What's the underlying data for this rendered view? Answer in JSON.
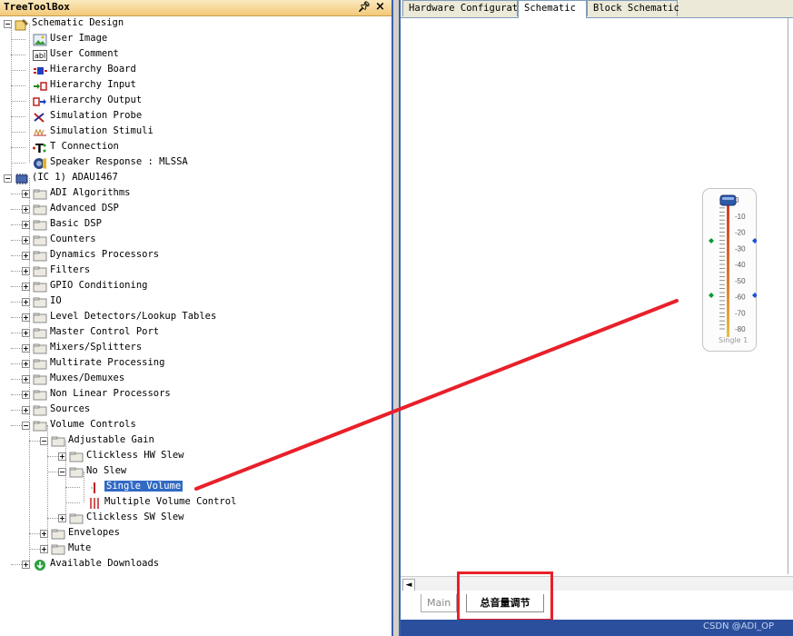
{
  "toolbox": {
    "title": "TreeToolBox",
    "pin_glyph": "٩",
    "close_glyph": "×",
    "items": [
      {
        "label": "Schematic Design",
        "level": 0,
        "expander": "minus",
        "icon": "schematic-design-icon"
      },
      {
        "label": "User Image",
        "level": 1,
        "expander": "",
        "icon": "image-icon"
      },
      {
        "label": "User Comment",
        "level": 1,
        "expander": "",
        "icon": "text-field-icon",
        "icon_text": "abl"
      },
      {
        "label": "Hierarchy Board",
        "level": 1,
        "expander": "",
        "icon": "hierarchy-board-icon"
      },
      {
        "label": "Hierarchy Input",
        "level": 1,
        "expander": "",
        "icon": "hierarchy-input-icon"
      },
      {
        "label": "Hierarchy Output",
        "level": 1,
        "expander": "",
        "icon": "hierarchy-output-icon"
      },
      {
        "label": "Simulation Probe",
        "level": 1,
        "expander": "",
        "icon": "probe-icon"
      },
      {
        "label": "Simulation Stimuli",
        "level": 1,
        "expander": "",
        "icon": "stimuli-icon"
      },
      {
        "label": "T Connection",
        "level": 1,
        "expander": "",
        "icon": "t-connection-icon",
        "icon_text": "T"
      },
      {
        "label": "Speaker Response : MLSSA",
        "level": 1,
        "expander": "",
        "icon": "speaker-icon"
      },
      {
        "label": "(IC 1) ADAU1467",
        "level": 0,
        "expander": "minus",
        "icon": "chip-icon"
      },
      {
        "label": "ADI Algorithms",
        "level": 1,
        "expander": "plus",
        "icon": "folder-icon"
      },
      {
        "label": "Advanced DSP",
        "level": 1,
        "expander": "plus",
        "icon": "folder-icon"
      },
      {
        "label": "Basic DSP",
        "level": 1,
        "expander": "plus",
        "icon": "folder-icon"
      },
      {
        "label": "Counters",
        "level": 1,
        "expander": "plus",
        "icon": "folder-icon"
      },
      {
        "label": "Dynamics Processors",
        "level": 1,
        "expander": "plus",
        "icon": "folder-icon"
      },
      {
        "label": "Filters",
        "level": 1,
        "expander": "plus",
        "icon": "folder-icon"
      },
      {
        "label": "GPIO Conditioning",
        "level": 1,
        "expander": "plus",
        "icon": "folder-icon"
      },
      {
        "label": "IO",
        "level": 1,
        "expander": "plus",
        "icon": "folder-icon"
      },
      {
        "label": "Level Detectors/Lookup Tables",
        "level": 1,
        "expander": "plus",
        "icon": "folder-icon"
      },
      {
        "label": "Master Control Port",
        "level": 1,
        "expander": "plus",
        "icon": "folder-icon"
      },
      {
        "label": "Mixers/Splitters",
        "level": 1,
        "expander": "plus",
        "icon": "folder-icon"
      },
      {
        "label": "Multirate Processing",
        "level": 1,
        "expander": "plus",
        "icon": "folder-icon"
      },
      {
        "label": "Muxes/Demuxes",
        "level": 1,
        "expander": "plus",
        "icon": "folder-icon"
      },
      {
        "label": "Non Linear Processors",
        "level": 1,
        "expander": "plus",
        "icon": "folder-icon"
      },
      {
        "label": "Sources",
        "level": 1,
        "expander": "plus",
        "icon": "folder-icon"
      },
      {
        "label": "Volume Controls",
        "level": 1,
        "expander": "minus",
        "icon": "folder-icon"
      },
      {
        "label": "Adjustable Gain",
        "level": 2,
        "expander": "minus",
        "icon": "folder-icon"
      },
      {
        "label": "Clickless HW Slew",
        "level": 3,
        "expander": "plus",
        "icon": "folder-icon"
      },
      {
        "label": "No Slew",
        "level": 3,
        "expander": "minus",
        "icon": "folder-icon"
      },
      {
        "label": "Single Volume",
        "level": 4,
        "expander": "",
        "icon": "single-volume-icon",
        "selected": true
      },
      {
        "label": "Multiple Volume Control",
        "level": 4,
        "expander": "",
        "icon": "multiple-volume-icon"
      },
      {
        "label": "Clickless SW Slew",
        "level": 3,
        "expander": "plus",
        "icon": "folder-icon"
      },
      {
        "label": "Envelopes",
        "level": 2,
        "expander": "plus",
        "icon": "folder-icon"
      },
      {
        "label": "Mute",
        "level": 2,
        "expander": "plus",
        "icon": "folder-icon"
      },
      {
        "label": "Available Downloads",
        "level": 1,
        "expander": "plus",
        "icon": "download-icon"
      }
    ]
  },
  "doc_tabs": [
    {
      "label": "Hardware Configuration",
      "active": false
    },
    {
      "label": "Schematic",
      "active": true
    },
    {
      "label": "Block Schematic",
      "active": false
    }
  ],
  "slider": {
    "ticks": [
      "0",
      "-10",
      "-20",
      "-30",
      "-40",
      "-50",
      "-60",
      "-70",
      "-80"
    ],
    "value_db": 0,
    "label": "Single 1"
  },
  "sheet_tabs": {
    "main": "Main",
    "active": "总音量调节"
  },
  "scroll_left_glyph": "◄",
  "watermark": "CSDN @ADI_OP",
  "colors": {
    "selection": "#316ac5",
    "annotation_red": "#e8202a",
    "title_bar": "#f3c877",
    "status_bar": "#2b4f9c"
  }
}
